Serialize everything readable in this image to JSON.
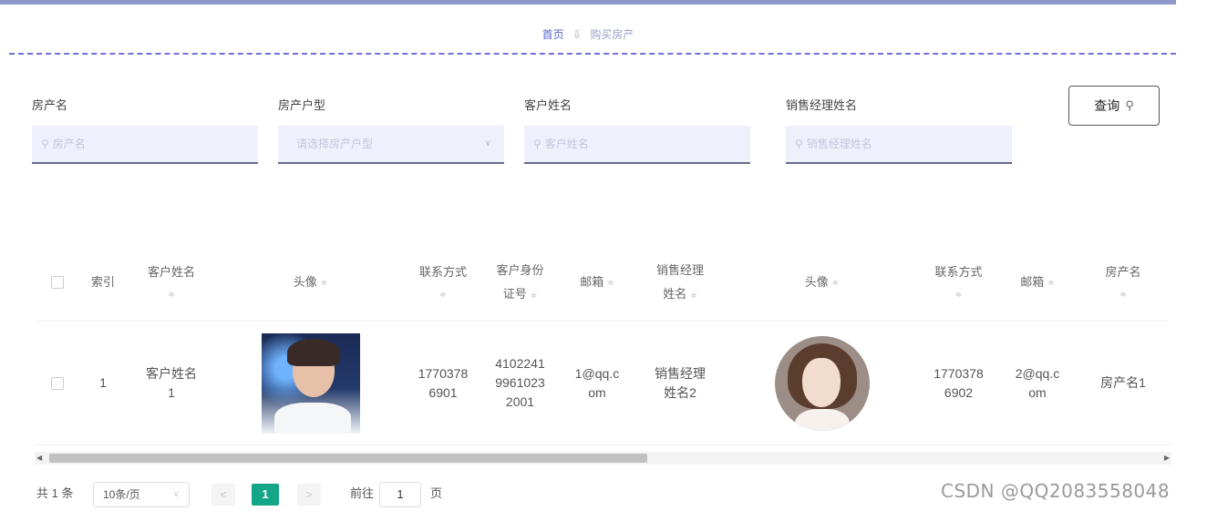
{
  "breadcrumb": {
    "home": "首页",
    "separator": "⇩",
    "current": "购买房产"
  },
  "search": {
    "fields": [
      {
        "label": "房产名",
        "placeholder": "房产名"
      },
      {
        "label": "房产户型",
        "placeholder": "请选择房产户型"
      },
      {
        "label": "客户姓名",
        "placeholder": "客户姓名"
      },
      {
        "label": "销售经理姓名",
        "placeholder": "销售经理姓名"
      }
    ],
    "search_icon": "search-icon",
    "query_button": "查询"
  },
  "table": {
    "sort_icon": "≑",
    "headers": {
      "index": "索引",
      "customer_name_1": "客户姓名",
      "avatar_1": "头像",
      "phone_1a": "联系方式",
      "id_1": "客户身份",
      "id_2": "证号",
      "email_1": "邮箱",
      "manager_1": "销售经理",
      "manager_2": "姓名",
      "avatar_2": "头像",
      "phone_2": "联系方式",
      "email_2": "邮箱",
      "property": "房产名"
    },
    "rows": [
      {
        "index": "1",
        "customer_name_1": "客户姓名",
        "customer_name_2": "1",
        "phone_1a": "1770378",
        "phone_1b": "6901",
        "id_a": "4102241",
        "id_b": "9961023",
        "id_c": "2001",
        "email_a": "1@qq.c",
        "email_b": "om",
        "manager_a": "销售经理",
        "manager_b": "姓名2",
        "phone_2a": "1770378",
        "phone_2b": "6902",
        "email_2a": "2@qq.c",
        "email_2b": "om",
        "property": "房产名1"
      }
    ]
  },
  "pagination": {
    "total": "共 1 条",
    "page_size": "10条/页",
    "current_page": "1",
    "goto_label": "前往",
    "goto_value": "1",
    "page_unit": "页"
  },
  "watermark": "CSDN @QQ2083558048"
}
